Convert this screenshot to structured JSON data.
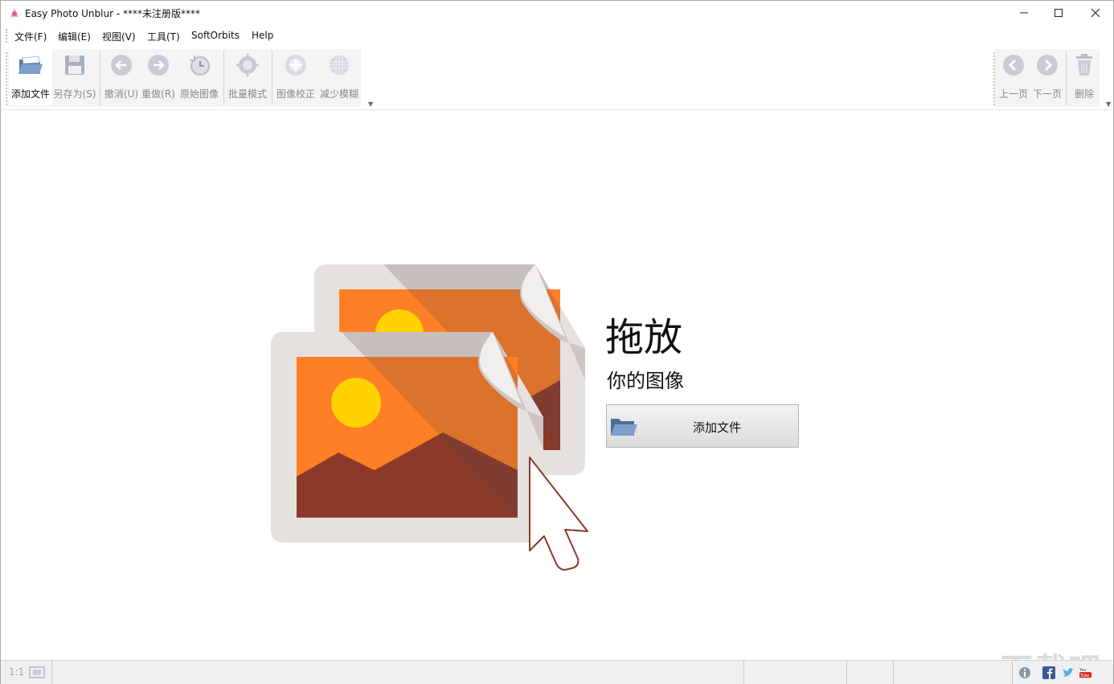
{
  "window": {
    "title": "Easy Photo Unblur - ****未注册版****"
  },
  "menu": {
    "items": [
      "文件(F)",
      "编辑(E)",
      "视图(V)",
      "工具(T)",
      "SoftOrbits",
      "Help"
    ]
  },
  "toolbar": {
    "add_file": "添加文件",
    "save_as": "另存为(S)",
    "undo": "撤消(U)",
    "redo": "重做(R)",
    "original": "原始图像",
    "batch": "批量模式",
    "correct": "图像校正",
    "reduce_blur": "减少模糊",
    "prev": "上一页",
    "next": "下一页",
    "delete": "删除"
  },
  "drop": {
    "title": "拖放",
    "subtitle": "你的图像",
    "button": "添加文件"
  },
  "status": {
    "zoom": "1:1"
  },
  "watermark": "下载吧",
  "colors": {
    "accent_orange": "#ff7f27",
    "mountain": "#8b3a2a",
    "sun": "#ffd200",
    "frame": "#e5e1de",
    "icon_blue": "#a9bdd6"
  }
}
